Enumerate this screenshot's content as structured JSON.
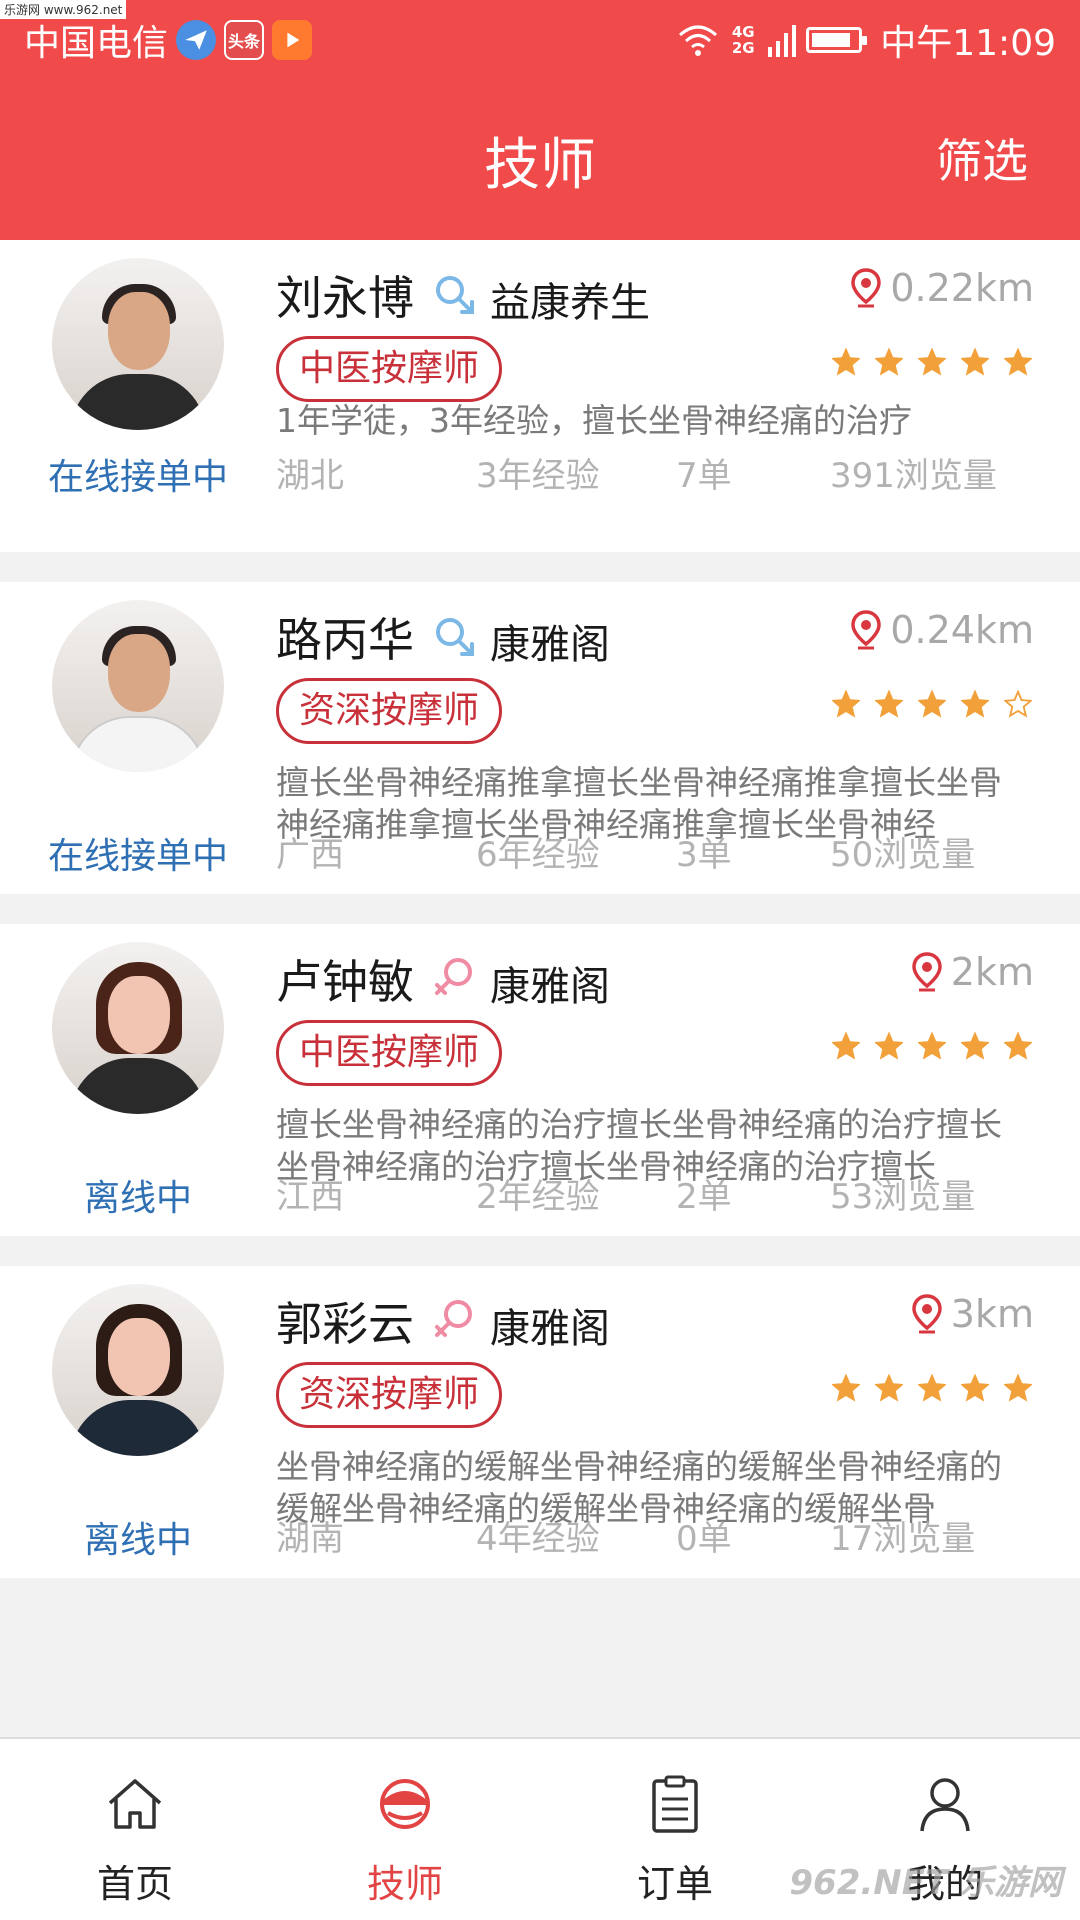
{
  "status_bar": {
    "carrier": "中国电信",
    "badges": [
      "paper-plane-icon",
      "头条",
      "video-icon"
    ],
    "network": "4G 2G",
    "time": "中午11:09",
    "battery_fraction": 0.85
  },
  "watermark_top": "乐游网 www.962.net",
  "header": {
    "title": "技师",
    "filter_label": "筛选"
  },
  "colors": {
    "header": "#f04a4a",
    "accent": "#c8303a",
    "online": "#2f6fb3",
    "star": "#f2a13a",
    "male_icon": "#7bb8e6",
    "female_icon": "#f08ba4"
  },
  "technicians": [
    {
      "name": "刘永博",
      "gender": "male",
      "shop": "益康养生",
      "distance": "0.22km",
      "tag": "中医按摩师",
      "rating": 5,
      "description": "1年学徒，3年经验，擅长坐骨神经痛的治疗",
      "status": "在线接单中",
      "region": "湖北",
      "experience": "3年经验",
      "orders": "7单",
      "views": "391浏览量"
    },
    {
      "name": "路丙华",
      "gender": "male",
      "shop": "康雅阁",
      "distance": "0.24km",
      "tag": "资深按摩师",
      "rating": 4,
      "description": "擅长坐骨神经痛推拿擅长坐骨神经痛推拿擅长坐骨神经痛推拿擅长坐骨神经痛推拿擅长坐骨神经",
      "status": "在线接单中",
      "region": "广西",
      "experience": "6年经验",
      "orders": "3单",
      "views": "50浏览量"
    },
    {
      "name": "卢钟敏",
      "gender": "female",
      "shop": "康雅阁",
      "distance": "2km",
      "tag": "中医按摩师",
      "rating": 5,
      "description": "擅长坐骨神经痛的治疗擅长坐骨神经痛的治疗擅长坐骨神经痛的治疗擅长坐骨神经痛的治疗擅长",
      "status": "离线中",
      "region": "江西",
      "experience": "2年经验",
      "orders": "2单",
      "views": "53浏览量"
    },
    {
      "name": "郭彩云",
      "gender": "female",
      "shop": "康雅阁",
      "distance": "3km",
      "tag": "资深按摩师",
      "rating": 5,
      "description": "坐骨神经痛的缓解坐骨神经痛的缓解坐骨神经痛的缓解坐骨神经痛的缓解坐骨神经痛的缓解坐骨",
      "status": "离线中",
      "region": "湖南",
      "experience": "4年经验",
      "orders": "0单",
      "views": "17浏览量"
    }
  ],
  "nav": [
    {
      "label": "首页",
      "icon": "home-icon",
      "active": false
    },
    {
      "label": "技师",
      "icon": "technician-icon",
      "active": true
    },
    {
      "label": "订单",
      "icon": "order-clipboard-icon",
      "active": false
    },
    {
      "label": "我的",
      "icon": "user-icon",
      "active": false
    }
  ],
  "watermark_bottom": "962.NET 乐游网"
}
